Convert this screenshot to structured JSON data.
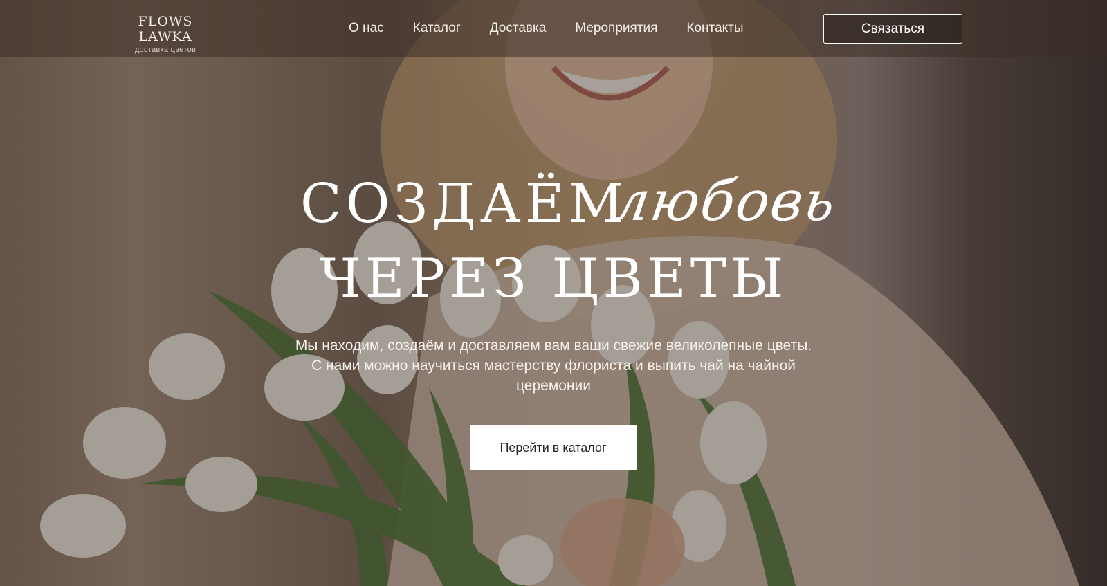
{
  "header": {
    "logo_name": "FLOWS LAWKA",
    "logo_tagline": "доставка цветов",
    "nav": [
      {
        "label": "О нас"
      },
      {
        "label": "Каталог"
      },
      {
        "label": "Доставка"
      },
      {
        "label": "Мероприятия"
      },
      {
        "label": "Контакты"
      }
    ],
    "active_nav": "Каталог",
    "contact_label": "Связаться"
  },
  "hero": {
    "title_line1": "СОЗДАЁМ",
    "title_script": "любовь",
    "title_line2": "ЧЕРЕЗ ЦВЕТЫ",
    "subtitle": "Мы находим, создаём и доставляем вам ваши свежие великолепные цветы. С нами можно научиться мастерству флориста и выпить чай на чайной церемонии",
    "cta_label": "Перейти в каталог",
    "background_image": "woman-with-white-tulips"
  },
  "colors": {
    "header_bg": "#3c2e26",
    "cta_bg": "#ffffff",
    "cta_text": "#2b2420",
    "text": "#ffffff"
  }
}
